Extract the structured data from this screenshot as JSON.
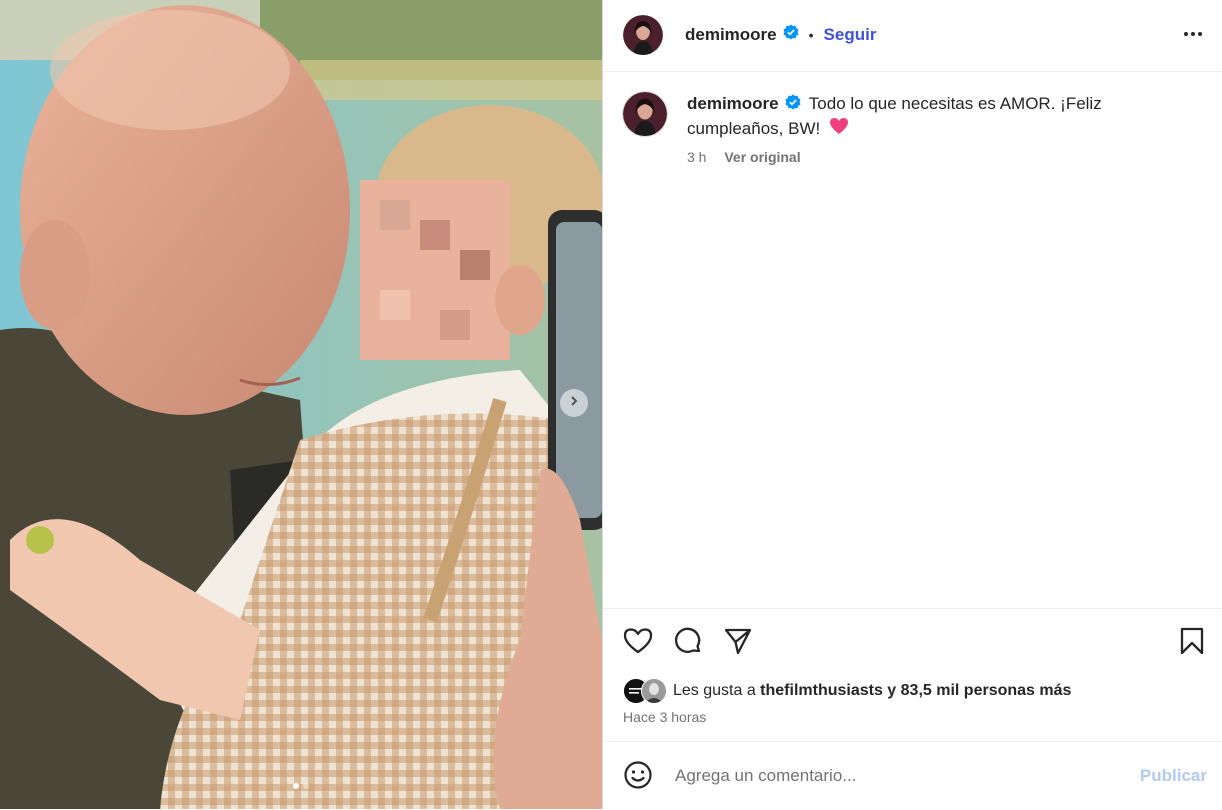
{
  "post": {
    "username": "demimoore",
    "separator": "•",
    "follow_label": "Seguir",
    "caption": "Todo lo que necesitas es AMOR. ¡Feliz cumpleaños, BW!",
    "caption_emoji": "heart",
    "age_short": "3 h",
    "see_original": "Ver original",
    "likes_prefix": "Les gusta a ",
    "likes_user": "thefilmthusiasts",
    "likes_suffix": " y 83,5 mil personas más",
    "posted_ago": "Hace 3 horas",
    "liker_avatar_text": "The Film Thusiasts"
  },
  "comment": {
    "placeholder": "Agrega un comentario...",
    "publish_label": "Publicar"
  },
  "carousel": {
    "count": 2,
    "active_index": 0
  },
  "icons": {
    "verified": "verified-badge-icon",
    "more": "more-options-icon",
    "like": "heart-icon",
    "comment": "comment-icon",
    "share": "send-icon",
    "save": "bookmark-icon",
    "emoji": "emoji-icon",
    "next": "chevron-right-icon"
  },
  "colors": {
    "follow": "#3f51e0",
    "verified": "#0095f6",
    "heart_emoji": "#f0407c",
    "publish_disabled": "#b3c8f2"
  }
}
